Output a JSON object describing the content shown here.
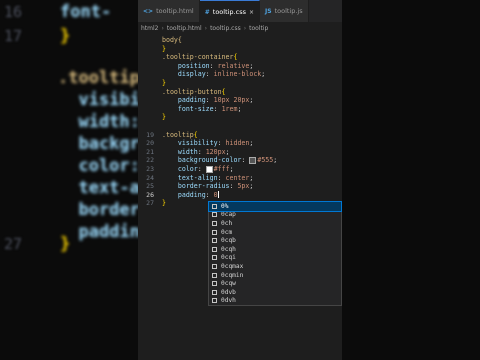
{
  "background": {
    "lines": [
      {
        "num": "16",
        "text": "font-",
        "color": "#9cdcfe"
      },
      {
        "num": "17",
        "text": "}",
        "color": "#ffd700"
      },
      {
        "num": "",
        "text": ".tooltip",
        "color": "#d7ba7d"
      },
      {
        "num": "",
        "text": "  visibi",
        "color": "#9cdcfe"
      },
      {
        "num": "",
        "text": "  width:",
        "color": "#9cdcfe"
      },
      {
        "num": "",
        "text": "  backgr",
        "color": "#9cdcfe"
      },
      {
        "num": "",
        "text": "  color:",
        "color": "#9cdcfe"
      },
      {
        "num": "",
        "text": "  text-a",
        "color": "#9cdcfe"
      },
      {
        "num": "",
        "text": "  border",
        "color": "#9cdcfe"
      },
      {
        "num": "",
        "text": "  paddin",
        "color": "#9cdcfe"
      },
      {
        "num": "27",
        "text": "}",
        "color": "#ffd700"
      }
    ]
  },
  "tabs": [
    {
      "icon": "<>",
      "label": "tooltip.html",
      "close": "",
      "active": false
    },
    {
      "icon": "#",
      "label": "tooltip.css",
      "close": "×",
      "active": true
    },
    {
      "icon": "JS",
      "label": "tooltip.js",
      "close": "",
      "active": false
    }
  ],
  "breadcrumb": [
    "html2",
    "tooltip.html",
    "tooltip.css",
    "tooltip"
  ],
  "code_lines": [
    {
      "num": "",
      "segs": [
        {
          "t": "body{",
          "c": "sel"
        }
      ]
    },
    {
      "num": "",
      "segs": [
        {
          "t": "}",
          "c": "brace"
        }
      ]
    },
    {
      "num": "",
      "segs": [
        {
          "t": ".tooltip-container",
          "c": "sel"
        },
        {
          "t": "{",
          "c": "brace"
        }
      ]
    },
    {
      "num": "",
      "segs": [
        {
          "t": "    position",
          "c": "prop"
        },
        {
          "t": ": ",
          "c": "pun"
        },
        {
          "t": "relative",
          "c": "val"
        },
        {
          "t": ";",
          "c": "pun"
        }
      ]
    },
    {
      "num": "",
      "segs": [
        {
          "t": "    display",
          "c": "prop"
        },
        {
          "t": ": ",
          "c": "pun"
        },
        {
          "t": "inline-block",
          "c": "val"
        },
        {
          "t": ";",
          "c": "pun"
        }
      ]
    },
    {
      "num": "",
      "segs": [
        {
          "t": "}",
          "c": "brace"
        }
      ]
    },
    {
      "num": "",
      "segs": [
        {
          "t": ".tooltip-button",
          "c": "sel"
        },
        {
          "t": "{",
          "c": "brace"
        }
      ]
    },
    {
      "num": "",
      "segs": [
        {
          "t": "    padding",
          "c": "prop"
        },
        {
          "t": ": ",
          "c": "pun"
        },
        {
          "t": "10px 20px",
          "c": "val"
        },
        {
          "t": ";",
          "c": "pun"
        }
      ]
    },
    {
      "num": "",
      "segs": [
        {
          "t": "    font-size",
          "c": "prop"
        },
        {
          "t": ": ",
          "c": "pun"
        },
        {
          "t": "1rem",
          "c": "val"
        },
        {
          "t": ";",
          "c": "pun"
        }
      ]
    },
    {
      "num": "",
      "segs": [
        {
          "t": "}",
          "c": "brace"
        }
      ]
    },
    {
      "num": "",
      "segs": []
    },
    {
      "num": "19",
      "segs": [
        {
          "t": ".tooltip",
          "c": "sel"
        },
        {
          "t": "{",
          "c": "brace"
        }
      ]
    },
    {
      "num": "20",
      "segs": [
        {
          "t": "    visibility",
          "c": "prop"
        },
        {
          "t": ": ",
          "c": "pun"
        },
        {
          "t": "hidden",
          "c": "val"
        },
        {
          "t": ";",
          "c": "pun"
        }
      ]
    },
    {
      "num": "21",
      "segs": [
        {
          "t": "    width",
          "c": "prop"
        },
        {
          "t": ": ",
          "c": "pun"
        },
        {
          "t": "120px",
          "c": "val"
        },
        {
          "t": ";",
          "c": "pun"
        }
      ]
    },
    {
      "num": "22",
      "segs": [
        {
          "t": "    background-color",
          "c": "prop"
        },
        {
          "t": ": ",
          "c": "pun"
        },
        {
          "t": "SW:#555",
          "c": "sw"
        },
        {
          "t": "#555",
          "c": "val"
        },
        {
          "t": ";",
          "c": "pun"
        }
      ]
    },
    {
      "num": "23",
      "segs": [
        {
          "t": "    color",
          "c": "prop"
        },
        {
          "t": ": ",
          "c": "pun"
        },
        {
          "t": "SW:#fff",
          "c": "sw"
        },
        {
          "t": "#fff",
          "c": "val"
        },
        {
          "t": ";",
          "c": "pun"
        }
      ]
    },
    {
      "num": "24",
      "segs": [
        {
          "t": "    text-align",
          "c": "prop"
        },
        {
          "t": ": ",
          "c": "pun"
        },
        {
          "t": "center",
          "c": "val"
        },
        {
          "t": ";",
          "c": "pun"
        }
      ]
    },
    {
      "num": "25",
      "segs": [
        {
          "t": "    border-radius",
          "c": "prop"
        },
        {
          "t": ": ",
          "c": "pun"
        },
        {
          "t": "5px",
          "c": "val"
        },
        {
          "t": ";",
          "c": "pun"
        }
      ]
    },
    {
      "num": "26",
      "segs": [
        {
          "t": "    padding",
          "c": "prop"
        },
        {
          "t": ": ",
          "c": "pun"
        },
        {
          "t": "0",
          "c": "val"
        },
        {
          "t": "CARET",
          "c": "caret"
        }
      ]
    },
    {
      "num": "27",
      "segs": [
        {
          "t": "}",
          "c": "brace"
        }
      ]
    }
  ],
  "current_line": "26",
  "suggestions": [
    "0%",
    "0cap",
    "0ch",
    "0cm",
    "0cqb",
    "0cqh",
    "0cqi",
    "0cqmax",
    "0cqmin",
    "0cqw",
    "0dvb",
    "0dvh"
  ]
}
